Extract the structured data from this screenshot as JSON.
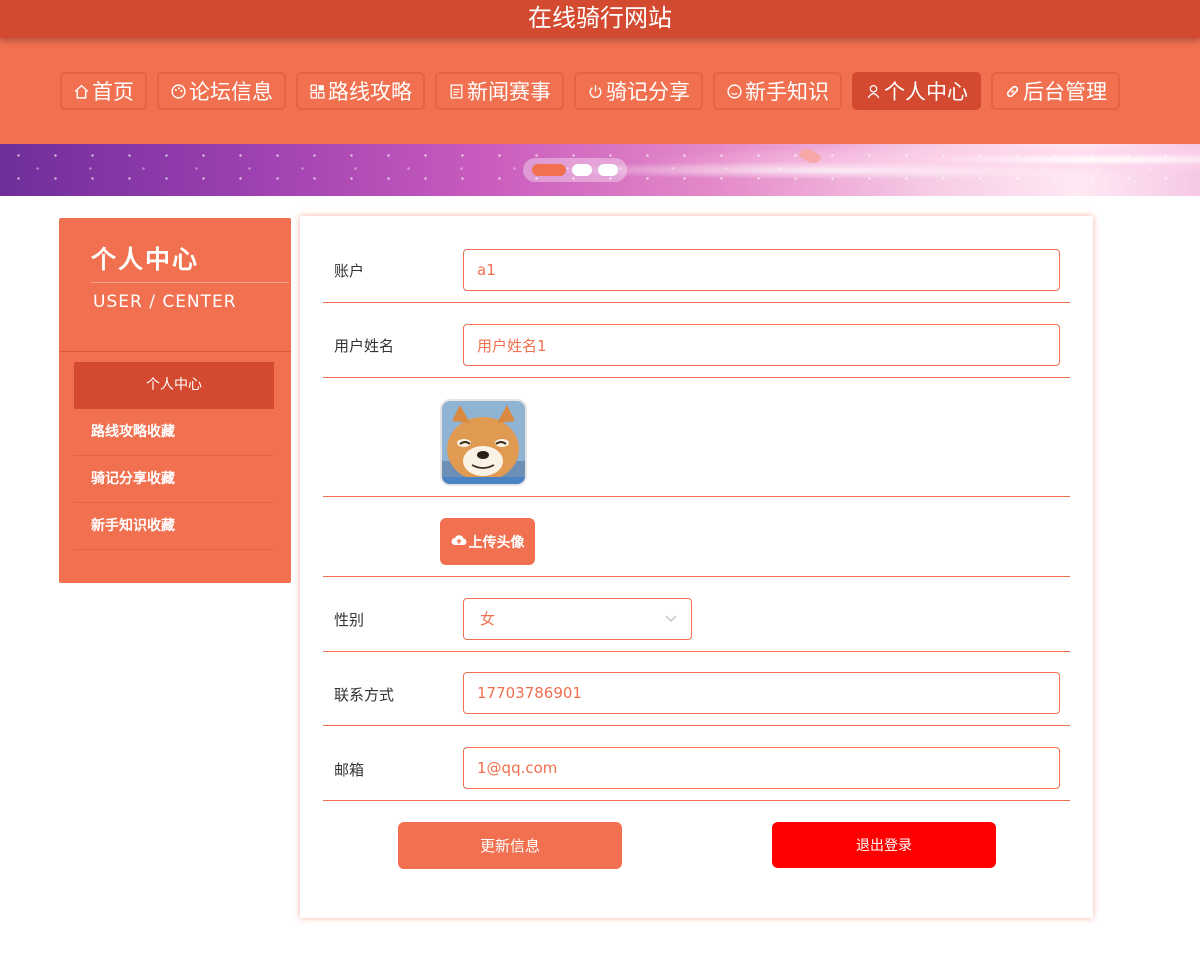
{
  "site": {
    "title": "在线骑行网站"
  },
  "nav": {
    "items": [
      {
        "label": "首页",
        "icon": "home-icon"
      },
      {
        "label": "论坛信息",
        "icon": "palette-icon"
      },
      {
        "label": "路线攻略",
        "icon": "grid-icon"
      },
      {
        "label": "新闻赛事",
        "icon": "document-icon"
      },
      {
        "label": "骑记分享",
        "icon": "power-icon"
      },
      {
        "label": "新手知识",
        "icon": "smile-icon"
      },
      {
        "label": "个人中心",
        "icon": "user-icon",
        "active": true
      },
      {
        "label": "后台管理",
        "icon": "link-icon"
      }
    ]
  },
  "sidebar": {
    "title": "个人中心",
    "subtitle": "USER / CENTER",
    "items": [
      {
        "label": "个人中心",
        "active": true
      },
      {
        "label": "路线攻略收藏"
      },
      {
        "label": "骑记分享收藏"
      },
      {
        "label": "新手知识收藏"
      }
    ]
  },
  "form": {
    "account": {
      "label": "账户",
      "value": "a1"
    },
    "username": {
      "label": "用户姓名",
      "value": "用户姓名1"
    },
    "upload_label": "上传头像",
    "gender": {
      "label": "性别",
      "value": "女"
    },
    "phone": {
      "label": "联系方式",
      "value": "17703786901"
    },
    "email": {
      "label": "邮箱",
      "value": "1@qq.com"
    }
  },
  "actions": {
    "update": "更新信息",
    "logout": "退出登录"
  },
  "colors": {
    "primary": "#f0704f",
    "dark": "#d44a30",
    "danger": "#ff0000"
  }
}
